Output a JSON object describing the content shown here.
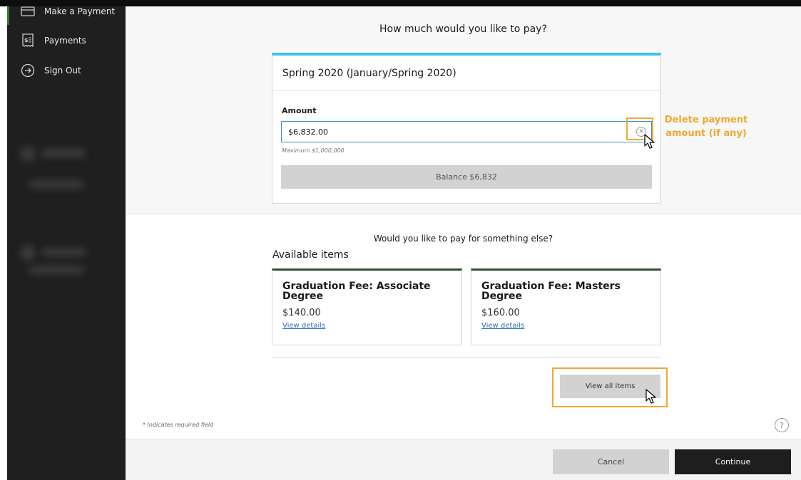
{
  "sidebar": {
    "items": [
      {
        "label": "Make a Payment",
        "icon": "card-icon"
      },
      {
        "label": "Payments",
        "icon": "receipt-icon"
      },
      {
        "label": "Sign Out",
        "icon": "sign-out-icon"
      }
    ]
  },
  "main": {
    "title": "How much would you like to pay?",
    "term": {
      "name": "Spring 2020 (January/Spring 2020)",
      "amount_label": "Amount",
      "amount_value": "$6,832.00",
      "max_hint": "Maximum $1,000,000",
      "balance_label": "Balance $6,832"
    },
    "annotation": "Delete payment amount (if any)",
    "else_title": "Would you like to pay for something else?",
    "available_title": "Available items",
    "items": [
      {
        "name": "Graduation Fee: Associate Degree",
        "price": "$140.00",
        "link": "View details"
      },
      {
        "name": "Graduation Fee: Masters Degree",
        "price": "$160.00",
        "link": "View details"
      }
    ],
    "view_all_label": "View all items",
    "required_star": "*",
    "required_note": "Indicates required field",
    "help_icon": "?"
  },
  "footer": {
    "cancel_label": "Cancel",
    "continue_label": "Continue"
  },
  "colors": {
    "accent_cyan": "#3cc3e8",
    "annotation_orange": "#f0a830",
    "card_top_green": "#2f4f2f",
    "sidebar_bg": "#1f1f1f",
    "active_marker_green": "#2e7d32"
  }
}
